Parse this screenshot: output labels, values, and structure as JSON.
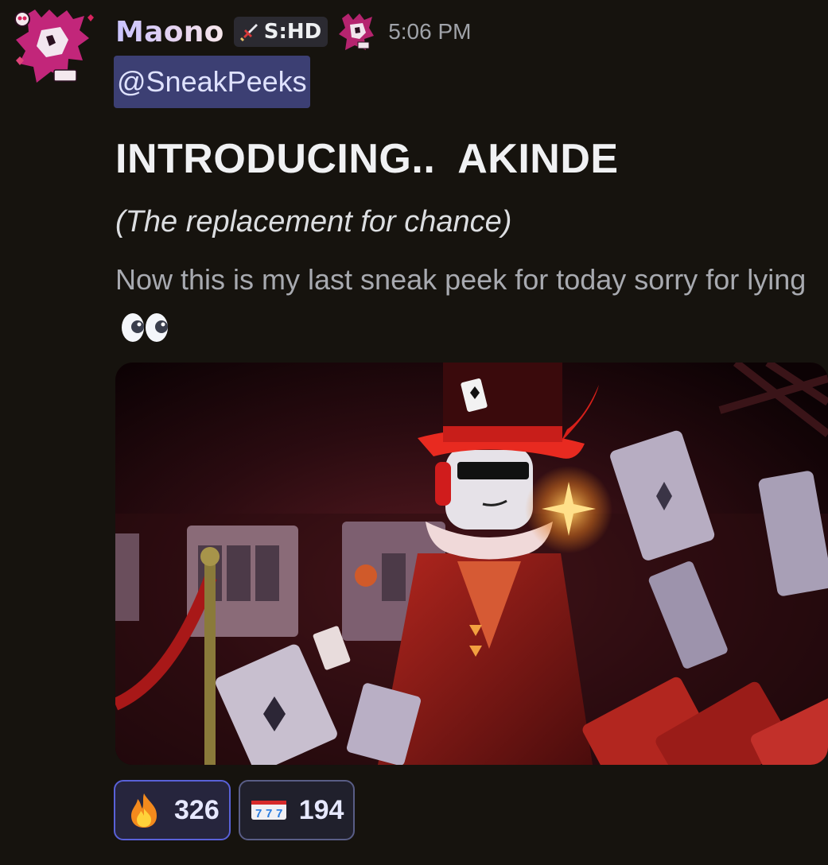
{
  "message": {
    "author": "Maono",
    "tag_label": "S:HD",
    "timestamp": "5:06 PM",
    "mention": "@SneakPeeks",
    "headline": "INTRODUCING..  AKINDE",
    "subheadline": "(The replacement for chance)",
    "body": "Now this is my last sneak peek for today sorry for lying",
    "body_emoji": "eyes-emoji",
    "attachment_icon": "akinde-character-image"
  },
  "reactions": [
    {
      "emoji": "fire-emoji",
      "count": "326"
    },
    {
      "emoji": "slot-machine-777-emoji",
      "count": "194"
    }
  ],
  "colors": {
    "background": "#16130e",
    "mention_bg": "#3c3f73",
    "reaction_border": "#5961d8"
  }
}
